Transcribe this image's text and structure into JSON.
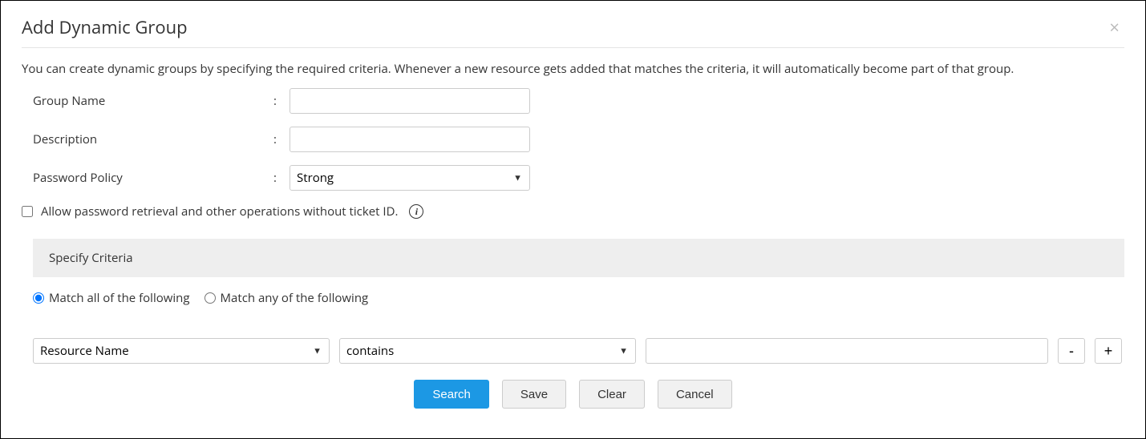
{
  "modal": {
    "title": "Add Dynamic Group",
    "intro": "You can create dynamic groups by specifying the required criteria. Whenever a new resource gets added that matches the criteria, it will automatically become part of that group."
  },
  "form": {
    "groupName": {
      "label": "Group Name",
      "value": ""
    },
    "description": {
      "label": "Description",
      "value": ""
    },
    "passwordPolicy": {
      "label": "Password Policy",
      "selected": "Strong"
    },
    "allowWithoutTicket": {
      "label": "Allow password retrieval and other operations without ticket ID.",
      "checked": false
    }
  },
  "criteria": {
    "header": "Specify Criteria",
    "matchAllLabel": "Match all of the following",
    "matchAnyLabel": "Match any of the following",
    "matchMode": "all",
    "rows": [
      {
        "field": "Resource Name",
        "operator": "contains",
        "value": ""
      }
    ]
  },
  "buttons": {
    "remove": "-",
    "add": "+",
    "search": "Search",
    "save": "Save",
    "clear": "Clear",
    "cancel": "Cancel"
  }
}
